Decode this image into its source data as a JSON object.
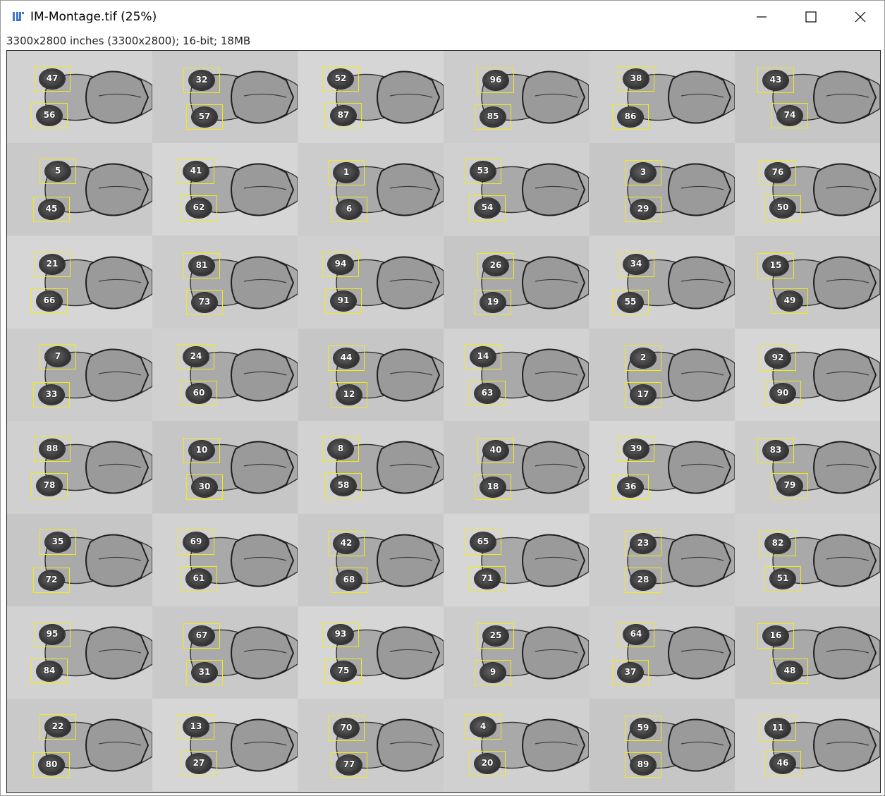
{
  "window": {
    "title": "IM-Montage.tif (25%)",
    "info": "3300x2800 inches (3300x2800); 16-bit; 18MB",
    "icons": {
      "app": "imagej-icon",
      "minimize": "minimize-icon",
      "maximize": "maximize-icon",
      "close": "close-icon"
    }
  },
  "montage": {
    "columns": 6,
    "rows": 8,
    "roi_color": "#f2ea1a",
    "tiles": [
      [
        [
          "47",
          "56"
        ],
        [
          "32",
          "57"
        ],
        [
          "52",
          "87"
        ],
        [
          "96",
          "85"
        ],
        [
          "38",
          "86"
        ],
        [
          "43",
          "74"
        ]
      ],
      [
        [
          "5",
          "45"
        ],
        [
          "41",
          "62"
        ],
        [
          "1",
          "6"
        ],
        [
          "53",
          "54"
        ],
        [
          "3",
          "29"
        ],
        [
          "76",
          "50"
        ]
      ],
      [
        [
          "21",
          "66"
        ],
        [
          "81",
          "73"
        ],
        [
          "94",
          "91"
        ],
        [
          "26",
          "19"
        ],
        [
          "34",
          "55"
        ],
        [
          "15",
          "49"
        ]
      ],
      [
        [
          "7",
          "33"
        ],
        [
          "24",
          "60"
        ],
        [
          "44",
          "12"
        ],
        [
          "14",
          "63"
        ],
        [
          "2",
          "17"
        ],
        [
          "92",
          "90"
        ]
      ],
      [
        [
          "88",
          "78"
        ],
        [
          "10",
          "30"
        ],
        [
          "8",
          "58"
        ],
        [
          "40",
          "18"
        ],
        [
          "39",
          "36"
        ],
        [
          "83",
          "79"
        ]
      ],
      [
        [
          "35",
          "72"
        ],
        [
          "69",
          "61"
        ],
        [
          "42",
          "68"
        ],
        [
          "65",
          "71"
        ],
        [
          "23",
          "28"
        ],
        [
          "82",
          "51"
        ]
      ],
      [
        [
          "95",
          "84"
        ],
        [
          "67",
          "31"
        ],
        [
          "93",
          "75"
        ],
        [
          "25",
          "9"
        ],
        [
          "64",
          "37"
        ],
        [
          "16",
          "48"
        ]
      ],
      [
        [
          "22",
          "80"
        ],
        [
          "13",
          "27"
        ],
        [
          "70",
          "77"
        ],
        [
          "4",
          "20"
        ],
        [
          "59",
          "89"
        ],
        [
          "11",
          "46"
        ]
      ]
    ]
  }
}
